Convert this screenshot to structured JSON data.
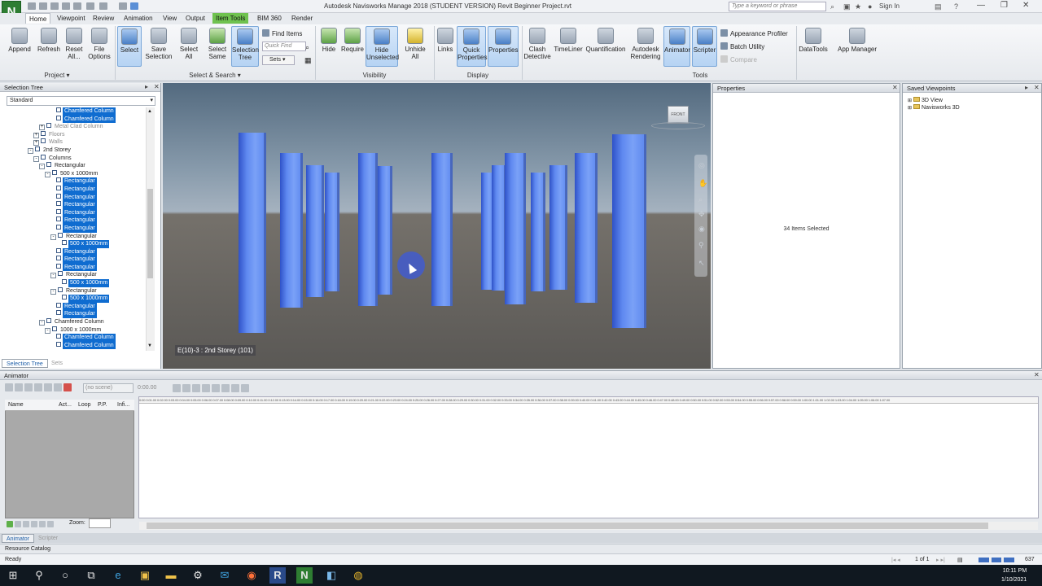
{
  "window": {
    "title": "Autodesk Navisworks Manage 2018 (STUDENT VERSION)   Revit Beginner Project.rvt",
    "logo": "N",
    "search_placeholder": "Type a keyword or phrase",
    "sign_in": "Sign In"
  },
  "tabs": [
    "Home",
    "Viewpoint",
    "Review",
    "Animation",
    "View",
    "Output",
    "Item Tools",
    "BIM 360",
    "Render"
  ],
  "ribbon": {
    "project_buttons": [
      "Append",
      "Refresh",
      "Reset All...",
      "File Options"
    ],
    "select_buttons": [
      "Select",
      "Save Selection",
      "Select All",
      "Select Same",
      "Selection Tree"
    ],
    "find_items": "Find Items",
    "quick_find_placeholder": "Quick Find",
    "sets": "Sets",
    "visibility_buttons": [
      "Hide",
      "Require",
      "Hide Unselected",
      "Unhide All"
    ],
    "display_buttons": [
      "Links",
      "Quick Properties",
      "Properties"
    ],
    "tools_buttons": [
      "Clash Detective",
      "TimeLiner",
      "Quantification",
      "Autodesk Rendering",
      "Animator",
      "Scripter"
    ],
    "tools_small": [
      "Appearance Profiler",
      "Batch Utility",
      "Compare"
    ],
    "extra_buttons": [
      "DataTools",
      "App Manager"
    ],
    "groups": [
      "Project",
      "Select & Search",
      "Visibility",
      "Display",
      "Tools"
    ]
  },
  "selection_tree": {
    "title": "Selection Tree",
    "dropdown": "Standard",
    "nodes": [
      {
        "label": "Chamfered Column",
        "level": 7,
        "sel": true,
        "tgl": ""
      },
      {
        "label": "Chamfered Column",
        "level": 7,
        "sel": true,
        "tgl": ""
      },
      {
        "label": "Metal Clad Column",
        "level": 4,
        "sel": false,
        "tgl": "+",
        "gray": true
      },
      {
        "label": "Floors",
        "level": 3,
        "sel": false,
        "tgl": "+",
        "gray": true
      },
      {
        "label": "Walls",
        "level": 3,
        "sel": false,
        "tgl": "+",
        "gray": true
      },
      {
        "label": "2nd Storey",
        "level": 2,
        "sel": false,
        "tgl": "-"
      },
      {
        "label": "Columns",
        "level": 3,
        "sel": false,
        "tgl": "-"
      },
      {
        "label": "Rectangular",
        "level": 4,
        "sel": false,
        "tgl": "-"
      },
      {
        "label": "500 x 1000mm",
        "level": 5,
        "sel": false,
        "tgl": "-"
      },
      {
        "label": "Rectangular",
        "level": 7,
        "sel": true,
        "tgl": ""
      },
      {
        "label": "Rectangular",
        "level": 7,
        "sel": true,
        "tgl": ""
      },
      {
        "label": "Rectangular",
        "level": 7,
        "sel": true,
        "tgl": ""
      },
      {
        "label": "Rectangular",
        "level": 7,
        "sel": true,
        "tgl": ""
      },
      {
        "label": "Rectangular",
        "level": 7,
        "sel": true,
        "tgl": ""
      },
      {
        "label": "Rectangular",
        "level": 7,
        "sel": true,
        "tgl": ""
      },
      {
        "label": "Rectangular",
        "level": 7,
        "sel": true,
        "tgl": ""
      },
      {
        "label": "Rectangular",
        "level": 6,
        "sel": false,
        "tgl": "-"
      },
      {
        "label": "500 x 1000mm",
        "level": 8,
        "sel": true,
        "tgl": ""
      },
      {
        "label": "Rectangular",
        "level": 7,
        "sel": true,
        "tgl": ""
      },
      {
        "label": "Rectangular",
        "level": 7,
        "sel": true,
        "tgl": ""
      },
      {
        "label": "Rectangular",
        "level": 7,
        "sel": true,
        "tgl": ""
      },
      {
        "label": "Rectangular",
        "level": 6,
        "sel": false,
        "tgl": "-"
      },
      {
        "label": "500 x 1000mm",
        "level": 8,
        "sel": true,
        "tgl": ""
      },
      {
        "label": "Rectangular",
        "level": 6,
        "sel": false,
        "tgl": "-"
      },
      {
        "label": "500 x 1000mm",
        "level": 8,
        "sel": true,
        "tgl": ""
      },
      {
        "label": "Rectangular",
        "level": 7,
        "sel": true,
        "tgl": ""
      },
      {
        "label": "Rectangular",
        "level": 7,
        "sel": true,
        "tgl": ""
      },
      {
        "label": "Chamfered Column",
        "level": 4,
        "sel": false,
        "tgl": "-"
      },
      {
        "label": "1000 x 1000mm",
        "level": 5,
        "sel": false,
        "tgl": "-"
      },
      {
        "label": "Chamfered Column",
        "level": 7,
        "sel": true,
        "tgl": ""
      },
      {
        "label": "Chamfered Column",
        "level": 7,
        "sel": true,
        "tgl": ""
      }
    ],
    "bottom_tabs": [
      "Selection Tree",
      "Sets"
    ]
  },
  "viewport": {
    "label": "E(10)-3 : 2nd Storey (101)",
    "cube_face": "FRONT"
  },
  "properties": {
    "title": "Properties",
    "status": "34 Items Selected"
  },
  "saved_viewpoints": {
    "title": "Saved Viewpoints",
    "items": [
      "3D View",
      "Navisworks 3D"
    ]
  },
  "animator": {
    "title": "Animator",
    "scene": "(no scene)",
    "time": "0:00.00",
    "columns": [
      "Name",
      "Act...",
      "Loop",
      "P.P.",
      "Infi..."
    ],
    "zoom_label": "Zoom:",
    "ruler": "0:00 0:01.00 0:02.00 0:03.00 0:04.00 0:05.00 0:06.00 0:07.00 0:08.00 0:09.00 0:10.00 0:11.00 0:12.00 0:13.00 0:14.00 0:15.00 0:16.00 0:17.00 0:18.00 0:19.00 0:20.00 0:21.00 0:22.00 0:23.00 0:24.00 0:25.00 0:26.00 0:27.00 0:28.00 0:29.00 0:30.00 0:31.00 0:32.00 0:33.00 0:34.00 0:35.00 0:36.00 0:37.00 0:38.00 0:39.00 0:40.00 0:41.00 0:42.00 0:43.00 0:44.00 0:45.00 0:46.00 0:47.00 0:48.00 0:49.00 0:50.00 0:51.00 0:52.00 0:53.00 0:54.00 0:55.00 0:56.00 0:57.00 0:58.00 0:59.00 1:00.00 1:01.00 1:02.00 1:03.00 1:04.00 1:05.00 1:06.00 1:07.00",
    "bottom_tabs": [
      "Animator",
      "Scripter"
    ]
  },
  "resource_catalog": "Resource Catalog",
  "status": {
    "text": "Ready",
    "page": "1 of 1",
    "memory": "637"
  },
  "clock": {
    "time": "10:11 PM",
    "date": "1/10/2021"
  }
}
